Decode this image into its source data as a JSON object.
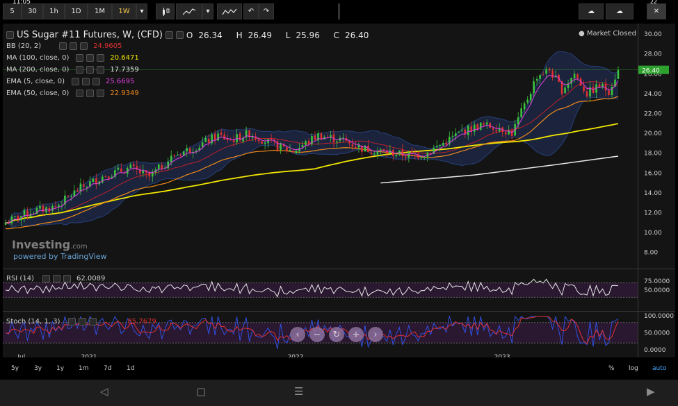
{
  "status_bar": {
    "time": "11:05",
    "battery": "22"
  },
  "toolbar": {
    "intervals": [
      "5",
      "30",
      "1h",
      "1D",
      "1M",
      "1W"
    ],
    "active_interval": "1W"
  },
  "instrument": {
    "title": "US Sugar #11 Futures, W, (CFD)",
    "ohlc": {
      "O": "26.34",
      "H": "26.49",
      "L": "25.96",
      "C": "26.40"
    },
    "market_status": "Market Closed",
    "last_price": "26.40"
  },
  "indicators": [
    {
      "name": "BB (20, 2)",
      "value": "24.9605",
      "color": "#e03030"
    },
    {
      "name": "MA (100, close, 0)",
      "value": "20.6471",
      "color": "#f2e600"
    },
    {
      "name": "MA (200, close, 0)",
      "value": "17.7359",
      "color": "#e8e8e8"
    },
    {
      "name": "EMA (5, close, 0)",
      "value": "25.6695",
      "color": "#e040e0"
    },
    {
      "name": "EMA (50, close, 0)",
      "value": "22.9349",
      "color": "#f08a1c"
    }
  ],
  "rsi": {
    "name": "RSI (14)",
    "value": "62.0089",
    "ticks": [
      "75.0000",
      "50.0000"
    ]
  },
  "stoch": {
    "name": "Stoch (14, 1, 3)",
    "value_d": "85.7679",
    "ticks": [
      "100.0000",
      "50.0000",
      "0.0000"
    ]
  },
  "watermark": {
    "brand": "Investing",
    "suffix": ".com",
    "powered": "powered by TradingView"
  },
  "range_buttons": [
    "5y",
    "3y",
    "1y",
    "1m",
    "7d",
    "1d"
  ],
  "scale_buttons": [
    "%",
    "log",
    "auto"
  ],
  "chart_data": {
    "type": "candlestick",
    "title": "US Sugar #11 Futures, W, (CFD)",
    "x_ticks": [
      "Jul",
      "2021",
      "2022",
      "2023"
    ],
    "y_ticks": [
      30,
      28,
      26,
      24,
      22,
      20,
      18,
      16,
      14,
      12,
      10,
      8
    ],
    "ylim": [
      7,
      30.5
    ],
    "price_anchors": [
      {
        "t": 0,
        "v": 11.0
      },
      {
        "t": 8,
        "v": 12.1
      },
      {
        "t": 16,
        "v": 12.6
      },
      {
        "t": 24,
        "v": 14.5
      },
      {
        "t": 32,
        "v": 15.8
      },
      {
        "t": 40,
        "v": 16.5
      },
      {
        "t": 46,
        "v": 15.6
      },
      {
        "t": 54,
        "v": 17.8
      },
      {
        "t": 62,
        "v": 18.8
      },
      {
        "t": 68,
        "v": 19.8
      },
      {
        "t": 72,
        "v": 19.3
      },
      {
        "t": 78,
        "v": 20.0
      },
      {
        "t": 86,
        "v": 18.8
      },
      {
        "t": 92,
        "v": 18.2
      },
      {
        "t": 100,
        "v": 19.8
      },
      {
        "t": 108,
        "v": 19.3
      },
      {
        "t": 114,
        "v": 18.5
      },
      {
        "t": 120,
        "v": 18.2
      },
      {
        "t": 128,
        "v": 17.8
      },
      {
        "t": 134,
        "v": 17.9
      },
      {
        "t": 140,
        "v": 19.0
      },
      {
        "t": 146,
        "v": 20.2
      },
      {
        "t": 152,
        "v": 20.8
      },
      {
        "t": 158,
        "v": 20.6
      },
      {
        "t": 162,
        "v": 20.0
      },
      {
        "t": 166,
        "v": 22.8
      },
      {
        "t": 170,
        "v": 25.8
      },
      {
        "t": 174,
        "v": 26.4
      },
      {
        "t": 178,
        "v": 24.4
      },
      {
        "t": 182,
        "v": 26.0
      },
      {
        "t": 186,
        "v": 24.0
      },
      {
        "t": 190,
        "v": 24.8
      },
      {
        "t": 193,
        "v": 24.3
      },
      {
        "t": 196,
        "v": 26.4
      }
    ],
    "ma200": [
      {
        "t": 120,
        "v": 15.0
      },
      {
        "t": 150,
        "v": 15.8
      },
      {
        "t": 175,
        "v": 16.8
      },
      {
        "t": 196,
        "v": 17.7
      }
    ],
    "current_price": 26.4,
    "rsi_range": [
      0,
      100
    ],
    "rsi_last": 62.0089,
    "stoch_last": 85.7679
  }
}
